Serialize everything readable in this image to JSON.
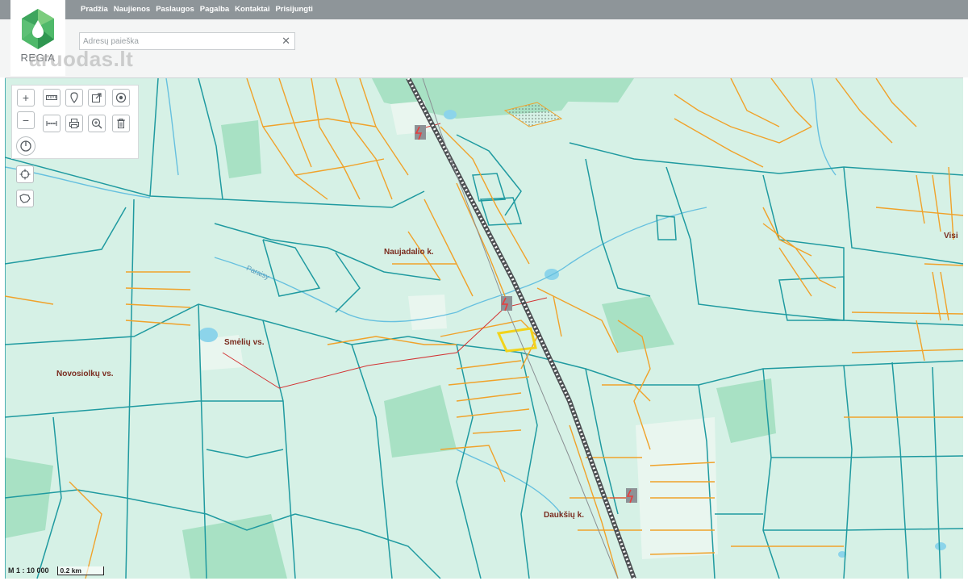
{
  "nav": {
    "items": [
      "Pradžia",
      "Naujienos",
      "Paslaugos",
      "Pagalba",
      "Kontaktai",
      "Prisijungti"
    ]
  },
  "logo": {
    "text": "REGIA"
  },
  "search": {
    "placeholder": "Adresų paieška",
    "value": "",
    "clear_glyph": "✕"
  },
  "watermark": {
    "text": "aruodas.lt"
  },
  "map": {
    "labels": {
      "naujadalio": "Naujadalio k.",
      "smeliu": "Smėlių vs.",
      "novosiolku": "Novosiolkų vs.",
      "dauksiu": "Daukšių k.",
      "visi": "Visi",
      "river": "Paraisy"
    },
    "scale_text": "M 1 : 10 000",
    "scale_bar_label": "0.2 km"
  },
  "toolbar": {
    "zoom_in": "+",
    "zoom_out": "−"
  },
  "icons": {
    "zoom_in": "plus-icon",
    "zoom_out": "minus-icon",
    "measure": "ruler-icon",
    "pin": "pin-icon",
    "export": "export-icon",
    "target": "target-icon",
    "measure_line": "measure-line-icon",
    "print": "print-icon",
    "search_area": "search-area-icon",
    "delete": "trash-icon",
    "power": "power-icon",
    "locate": "crosshair-icon",
    "layers": "region-icon"
  },
  "colors": {
    "map_background": "#d6f1e6",
    "parcel_teal": "#1f9aa0",
    "parcel_orange": "#f0a22a",
    "forest": "#9cdcbd",
    "railway": "#4c4f52",
    "power_line": "#d23333",
    "highlight_parcel": "#f2d31b",
    "nav_bar": "#8e9599"
  }
}
